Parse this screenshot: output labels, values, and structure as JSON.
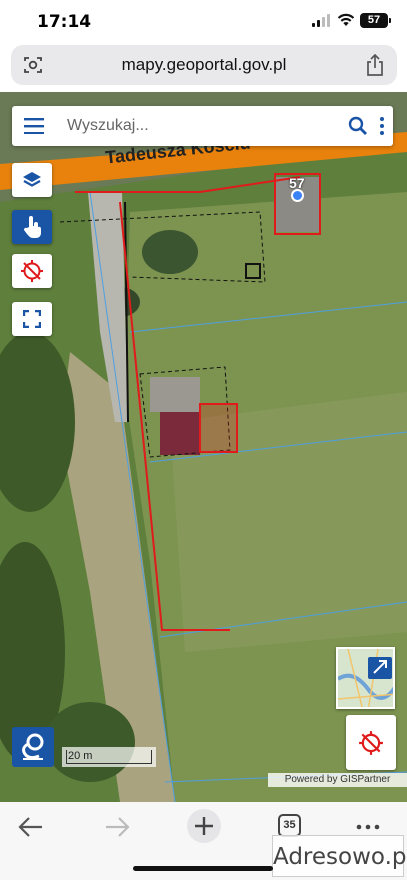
{
  "status": {
    "time": "17:14",
    "battery": "57"
  },
  "browser": {
    "url": "mapy.geoportal.gov.pl",
    "tab_count": "35"
  },
  "map": {
    "search_placeholder": "Wyszukaj...",
    "street_label": "Tadeusza Kościu",
    "parcel_label": "57",
    "scale_label": "20 m",
    "credit": "Powered by GISPartner"
  },
  "watermark": "Adresowo.pl",
  "colors": {
    "accent": "#1a54a5",
    "parcel": "#e01b1b"
  },
  "icons": {
    "menu": "menu-icon",
    "search": "search-icon",
    "more": "kebab-icon",
    "layers": "layers-icon",
    "identify": "hand-pointer-icon",
    "locate": "locate-off-icon",
    "fullscreen": "fullscreen-icon",
    "open_map": "open-external-icon",
    "geoportal": "geoportal-logo-icon"
  }
}
